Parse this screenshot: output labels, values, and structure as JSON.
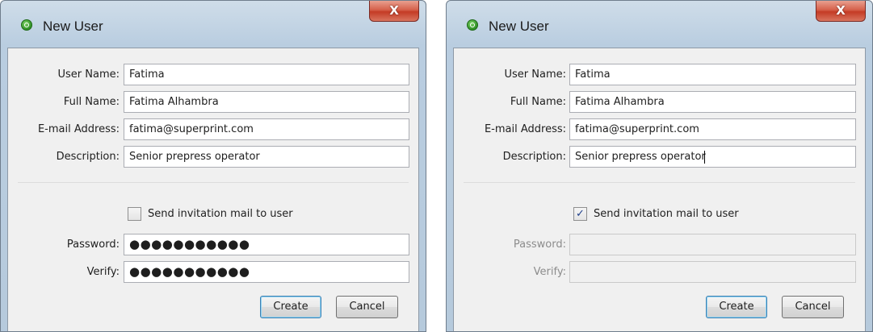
{
  "dialogs": [
    {
      "title": "New User",
      "close_label": "X",
      "fields": {
        "user_name": {
          "label": "User Name:",
          "value": "Fatima"
        },
        "full_name": {
          "label": "Full Name:",
          "value": "Fatima Alhambra"
        },
        "email": {
          "label": "E-mail Address:",
          "value": "fatima@superprint.com"
        },
        "description": {
          "label": "Description:",
          "value": "Senior prepress operator"
        },
        "password": {
          "label": "Password:",
          "value": "●●●●●●●●●●●",
          "enabled": true
        },
        "verify": {
          "label": "Verify:",
          "value": "●●●●●●●●●●●",
          "enabled": true
        }
      },
      "send_invitation": {
        "label": "Send invitation mail to user",
        "checked": false,
        "mark": ""
      },
      "buttons": {
        "create": "Create",
        "cancel": "Cancel"
      }
    },
    {
      "title": "New User",
      "close_label": "X",
      "fields": {
        "user_name": {
          "label": "User Name:",
          "value": "Fatima"
        },
        "full_name": {
          "label": "Full Name:",
          "value": "Fatima Alhambra"
        },
        "email": {
          "label": "E-mail Address:",
          "value": "fatima@superprint.com"
        },
        "description": {
          "label": "Description:",
          "value": "Senior prepress operator"
        },
        "password": {
          "label": "Password:",
          "value": "",
          "enabled": false
        },
        "verify": {
          "label": "Verify:",
          "value": "",
          "enabled": false
        }
      },
      "send_invitation": {
        "label": "Send invitation mail to user",
        "checked": true,
        "mark": "✓"
      },
      "buttons": {
        "create": "Create",
        "cancel": "Cancel"
      }
    }
  ],
  "colors": {
    "frame": "#b9cde0",
    "client_background": "#f0f0f0",
    "close_button": "#c43b25",
    "default_button_border": "#3c7fb1",
    "app_icon": "#2e8f24"
  }
}
